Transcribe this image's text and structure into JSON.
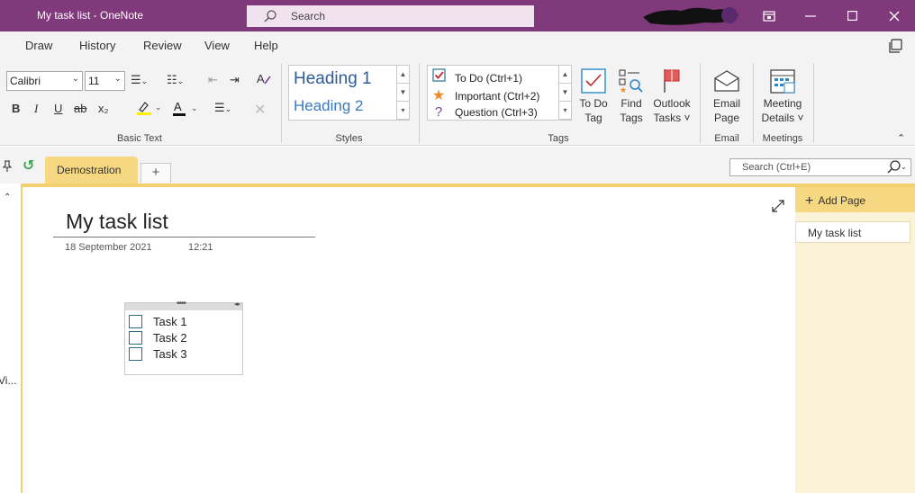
{
  "titlebar": {
    "title": "My task list  -  OneNote",
    "search_label": "Search"
  },
  "menu": {
    "tabs": [
      "Draw",
      "History",
      "Review",
      "View",
      "Help"
    ]
  },
  "ribbon": {
    "font_name": "Calibri",
    "font_size": "11",
    "groups": {
      "basic_text": "Basic Text",
      "styles": "Styles",
      "tags": "Tags",
      "email": "Email",
      "meetings": "Meetings"
    },
    "styles": [
      "Heading 1",
      "Heading 2"
    ],
    "tags": [
      {
        "label": "To Do (Ctrl+1)",
        "icon": "checkbox-icon"
      },
      {
        "label": "Important (Ctrl+2)",
        "icon": "star-icon"
      },
      {
        "label": "Question (Ctrl+3)",
        "icon": "question-icon"
      }
    ],
    "buttons": {
      "todo_tag": [
        "To Do",
        "Tag"
      ],
      "find_tags": [
        "Find",
        "Tags"
      ],
      "outlook_tasks": [
        "Outlook",
        "Tasks ˅"
      ],
      "email_page": [
        "Email",
        "Page"
      ],
      "meeting_details": [
        "Meeting",
        "Details ˅"
      ]
    },
    "format_labels": {
      "bold": "B",
      "italic": "I",
      "underline": "U",
      "strikethrough": "ab",
      "subscript": "x₂",
      "font_color": "A",
      "clear": "✕"
    }
  },
  "notebook": {
    "section_tab": "Demostration",
    "add_tab": "+",
    "search_placeholder": "Search (Ctrl+E)"
  },
  "leftnav": {
    "partial_text": "Vi..."
  },
  "page": {
    "title": "My task list",
    "date": "18 September 2021",
    "time": "12:21",
    "tasks": [
      "Task 1",
      "Task 2",
      "Task 3"
    ]
  },
  "pages_pane": {
    "add_page": "Add Page",
    "items": [
      "My task list"
    ]
  },
  "colors": {
    "accent": "#80397b",
    "section": "#f6d882"
  }
}
